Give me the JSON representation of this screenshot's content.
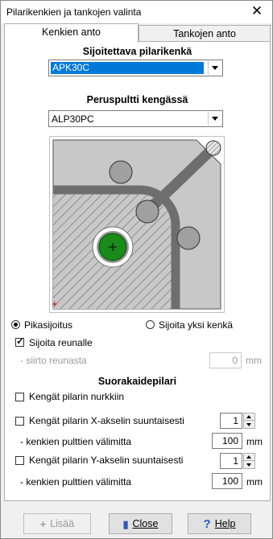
{
  "window": {
    "title": "Pilarikenkien ja tankojen valinta",
    "close_glyph": "✕"
  },
  "tabs": [
    {
      "label": "Kenkien anto",
      "active": true
    },
    {
      "label": "Tankojen anto",
      "active": false
    }
  ],
  "shoe": {
    "heading": "Sijoitettava pilarikenkä",
    "value": "APK30C"
  },
  "bolt": {
    "heading": "Peruspultti kengässä",
    "value": "ALP30PC"
  },
  "diagram": {
    "origin_marker": "+"
  },
  "placement": {
    "quick_label": "Pikasijoitus",
    "quick_selected": true,
    "single_label": "Sijoita yksi kenkä",
    "single_selected": false,
    "edge_label": "Sijoita reunalle",
    "edge_checked": true,
    "offset_label": "- siirto reunasta",
    "offset_value": "0",
    "offset_unit": "mm"
  },
  "rect_column": {
    "heading": "Suorakaidepilari",
    "corners_label": "Kengät pilarin nurkkiin",
    "corners_checked": false,
    "x_label": "Kengät pilarin X-akselin suuntaisesti",
    "x_checked": false,
    "x_count": "1",
    "x_spacing_label": "- kenkien pulttien välimitta",
    "x_spacing_value": "100",
    "x_spacing_unit": "mm",
    "y_label": "Kengät pilarin Y-akselin suuntaisesti",
    "y_checked": false,
    "y_count": "1",
    "y_spacing_label": "- kenkien pulttien välimitta",
    "y_spacing_value": "100",
    "y_spacing_unit": "mm"
  },
  "buttons": {
    "add_label": "Lisää",
    "close_label": "Close",
    "help_label": "Help"
  },
  "colors": {
    "selection": "#0078d7",
    "bolt_green": "#1a8a1a",
    "plate_grey": "#c8c8c8",
    "dark_grey": "#707070"
  }
}
